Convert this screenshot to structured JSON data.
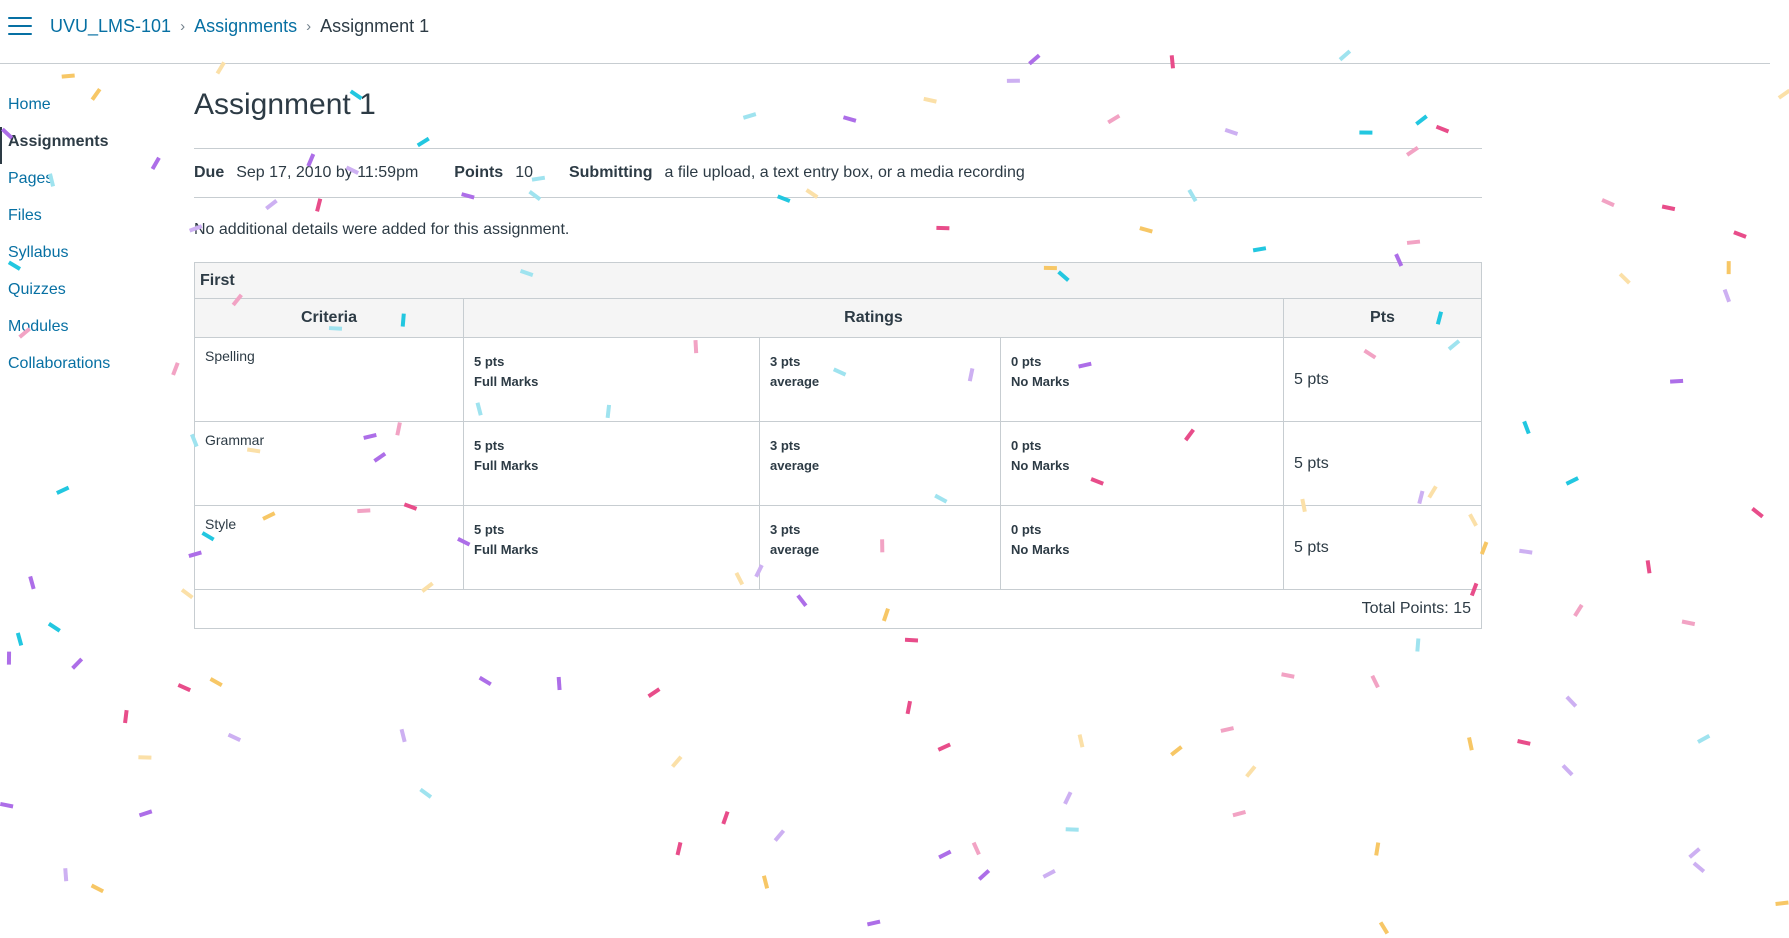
{
  "breadcrumb": {
    "course": "UVU_LMS-101",
    "section": "Assignments",
    "current": "Assignment 1"
  },
  "icons": {
    "menu": "hamburger-menu-icon",
    "separator": "chevron-right-icon"
  },
  "colors": {
    "link": "#0770a3",
    "text": "#2d3b45",
    "border": "#c7cdd1",
    "header_bg": "#f5f5f5"
  },
  "sidebar": {
    "items": [
      {
        "label": "Home"
      },
      {
        "label": "Assignments",
        "active": true
      },
      {
        "label": "Pages"
      },
      {
        "label": "Files"
      },
      {
        "label": "Syllabus"
      },
      {
        "label": "Quizzes"
      },
      {
        "label": "Modules"
      },
      {
        "label": "Collaborations"
      }
    ]
  },
  "assignment": {
    "title": "Assignment 1",
    "due_label": "Due",
    "due_value": "Sep 17, 2010 by 11:59pm",
    "points_label": "Points",
    "points_value": "10",
    "submitting_label": "Submitting",
    "submitting_value": "a file upload, a text entry box, or a media recording",
    "note": "No additional details were added for this assignment."
  },
  "rubric": {
    "title": "First",
    "headers": {
      "criteria": "Criteria",
      "ratings": "Ratings",
      "pts": "Pts"
    },
    "rows": [
      {
        "criterion": "Spelling",
        "ratings": [
          {
            "pts": "5 pts",
            "label": "Full Marks"
          },
          {
            "pts": "3 pts",
            "label": "average"
          },
          {
            "pts": "0 pts",
            "label": "No Marks"
          }
        ],
        "pts": "5 pts"
      },
      {
        "criterion": "Grammar",
        "ratings": [
          {
            "pts": "5 pts",
            "label": "Full Marks"
          },
          {
            "pts": "3 pts",
            "label": "average"
          },
          {
            "pts": "0 pts",
            "label": "No Marks"
          }
        ],
        "pts": "5 pts"
      },
      {
        "criterion": "Style",
        "ratings": [
          {
            "pts": "5 pts",
            "label": "Full Marks"
          },
          {
            "pts": "3 pts",
            "label": "average"
          },
          {
            "pts": "0 pts",
            "label": "No Marks"
          }
        ],
        "pts": "5 pts"
      }
    ],
    "total": "Total Points: 15"
  }
}
